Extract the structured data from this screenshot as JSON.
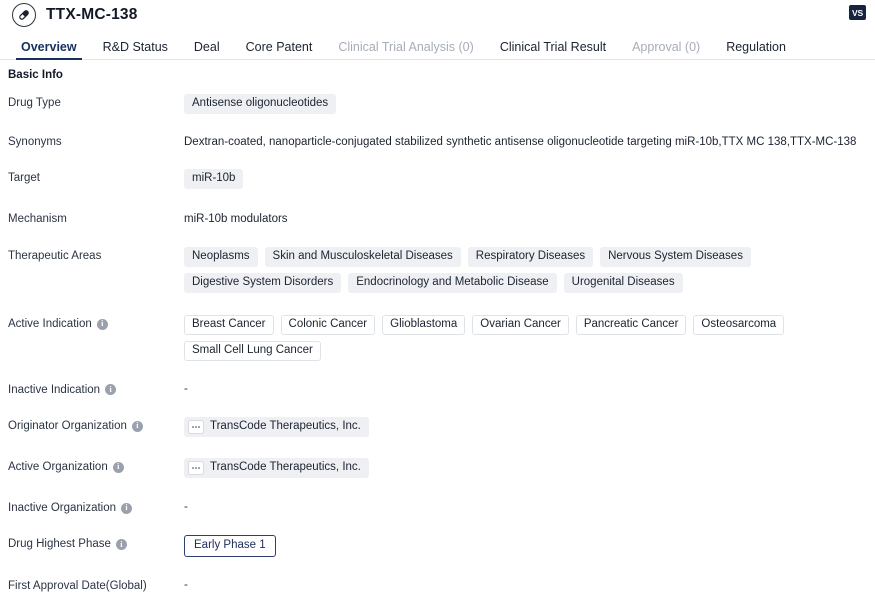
{
  "header": {
    "drug_name": "TTX-MC-138",
    "logo_icon": "capsule-pill-icon",
    "vs_badge": "VS"
  },
  "tabs": [
    {
      "label": "Overview",
      "state": "active"
    },
    {
      "label": "R&D Status",
      "state": "normal"
    },
    {
      "label": "Deal",
      "state": "normal"
    },
    {
      "label": "Core Patent",
      "state": "normal"
    },
    {
      "label": "Clinical Trial Analysis (0)",
      "state": "muted"
    },
    {
      "label": "Clinical Trial Result",
      "state": "normal"
    },
    {
      "label": "Approval (0)",
      "state": "muted"
    },
    {
      "label": "Regulation",
      "state": "normal"
    }
  ],
  "section": {
    "title": "Basic Info"
  },
  "rows": {
    "drug_type": {
      "label": "Drug Type",
      "chips": [
        "Antisense oligonucleotides"
      ]
    },
    "synonyms": {
      "label": "Synonyms",
      "text": "Dextran-coated, nanoparticle-conjugated stabilized synthetic antisense oligonucleotide targeting miR-10b,TTX MC 138,TTX-MC-138"
    },
    "target": {
      "label": "Target",
      "chips": [
        "miR-10b"
      ]
    },
    "mechanism": {
      "label": "Mechanism",
      "text": "miR-10b modulators"
    },
    "therapeutic_areas": {
      "label": "Therapeutic Areas",
      "chips": [
        "Neoplasms",
        "Skin and Musculoskeletal Diseases",
        "Respiratory Diseases",
        "Nervous System Diseases",
        "Digestive System Disorders",
        "Endocrinology and Metabolic Disease",
        "Urogenital Diseases"
      ]
    },
    "active_indication": {
      "label": "Active Indication",
      "has_info": true,
      "chips": [
        "Breast Cancer",
        "Colonic Cancer",
        "Glioblastoma",
        "Ovarian Cancer",
        "Pancreatic Cancer",
        "Osteosarcoma",
        "Small Cell Lung Cancer"
      ]
    },
    "inactive_indication": {
      "label": "Inactive Indication",
      "has_info": true,
      "value": "-"
    },
    "originator_organization": {
      "label": "Originator Organization",
      "has_info": true,
      "orgs": [
        "TransCode Therapeutics, Inc."
      ]
    },
    "active_organization": {
      "label": "Active Organization",
      "has_info": true,
      "orgs": [
        "TransCode Therapeutics, Inc."
      ]
    },
    "inactive_organization": {
      "label": "Inactive Organization",
      "has_info": true,
      "value": "-"
    },
    "drug_highest_phase": {
      "label": "Drug Highest Phase",
      "has_info": true,
      "phase": "Early Phase 1"
    },
    "first_approval_date": {
      "label": "First Approval Date(Global)",
      "value": "-"
    }
  },
  "colors": {
    "accent_navy": "#18305e",
    "chip_bg": "#eff0f3",
    "muted_text": "#a7adb8",
    "badge_bg": "#15243f"
  }
}
